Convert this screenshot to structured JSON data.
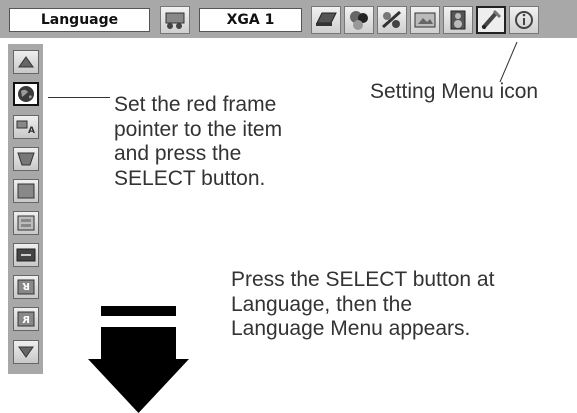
{
  "toolbar": {
    "menu_title": "Language",
    "input_source": "XGA 1",
    "icons": [
      "input-icon",
      "computer-system-icon",
      "image-select-icon",
      "image-adjust-icon",
      "screen-icon",
      "sound-icon",
      "setting-icon",
      "information-icon"
    ]
  },
  "sidebar": {
    "icons": [
      "scroll-up-icon",
      "language-icon",
      "auto-setup-icon",
      "keystone-icon",
      "background-icon",
      "display-icon",
      "logo-icon",
      "ceiling-icon",
      "rear-icon",
      "scroll-down-icon"
    ]
  },
  "callouts": {
    "setting_menu_icon": "Setting Menu icon",
    "pointer_instruction": "Set the red frame\npointer to the item\nand press the\nSELECT button.",
    "select_instruction": "Press the SELECT button at\nLanguage, then the\nLanguage Menu appears."
  },
  "colors": {
    "menu_background": "#a8a8a8",
    "arrow": "#000000"
  }
}
